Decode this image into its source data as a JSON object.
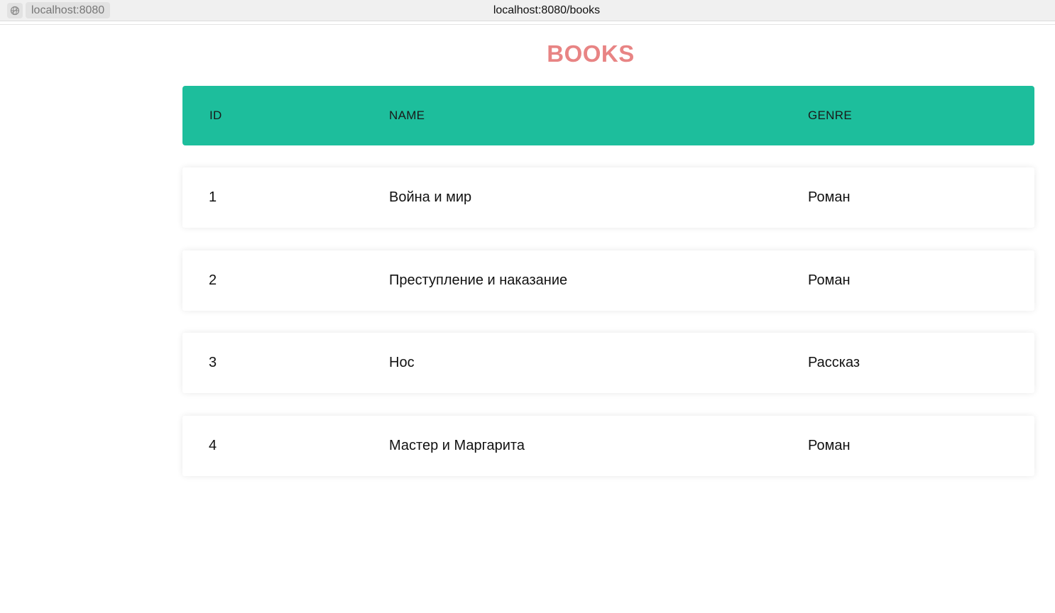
{
  "browser": {
    "site_label": "localhost:8080",
    "address": "localhost:8080/books"
  },
  "page": {
    "title": "BOOKS"
  },
  "table": {
    "columns": [
      "ID",
      "NAME",
      "GENRE"
    ],
    "rows": [
      {
        "id": "1",
        "name": "Война и мир",
        "genre": "Роман"
      },
      {
        "id": "2",
        "name": "Преступление и наказание",
        "genre": "Роман"
      },
      {
        "id": "3",
        "name": "Нос",
        "genre": "Рассказ"
      },
      {
        "id": "4",
        "name": "Мастер и Маргарита",
        "genre": "Роман"
      }
    ]
  },
  "colors": {
    "header_background": "#1dbe9c",
    "title": "#e88484"
  },
  "icons": {
    "site_icon": "globe-icon"
  }
}
